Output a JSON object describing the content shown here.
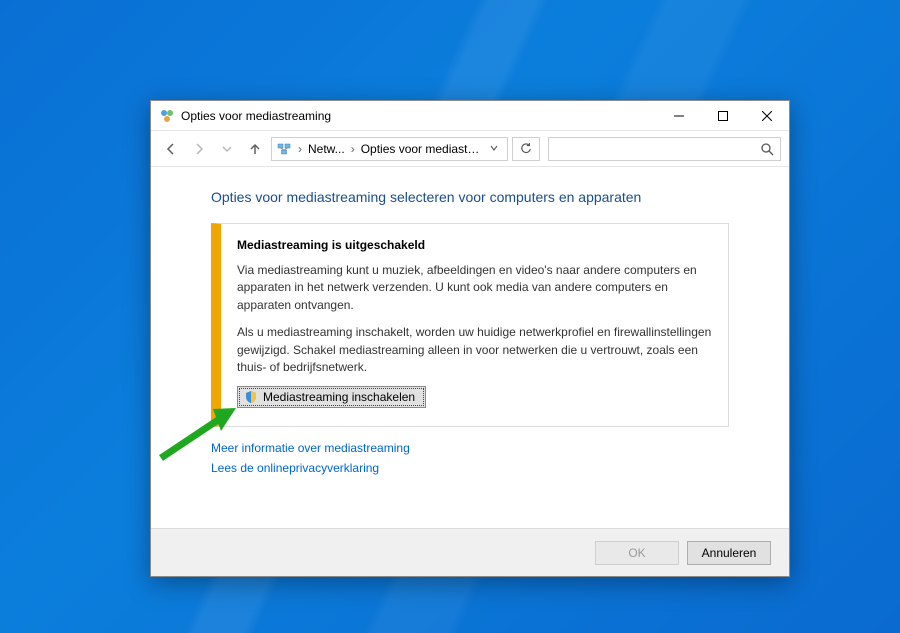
{
  "window": {
    "title": "Opties voor mediastreaming"
  },
  "breadcrumb": {
    "item1": "Netw...",
    "item2": "Opties voor mediastre..."
  },
  "heading": "Opties voor mediastreaming selecteren voor computers en apparaten",
  "panel": {
    "title": "Mediastreaming is uitgeschakeld",
    "para1": "Via mediastreaming kunt u muziek, afbeeldingen en video's naar andere computers en apparaten in het netwerk verzenden. U kunt ook media van andere computers en apparaten ontvangen.",
    "para2": "Als u mediastreaming inschakelt, worden uw huidige netwerkprofiel en firewallinstellingen gewijzigd. Schakel mediastreaming alleen in voor netwerken die u vertrouwt, zoals een thuis- of bedrijfsnetwerk.",
    "enable_button": "Mediastreaming inschakelen"
  },
  "links": {
    "more_info": "Meer informatie over mediastreaming",
    "privacy": "Lees de onlineprivacyverklaring"
  },
  "buttons": {
    "ok": "OK",
    "cancel": "Annuleren"
  }
}
